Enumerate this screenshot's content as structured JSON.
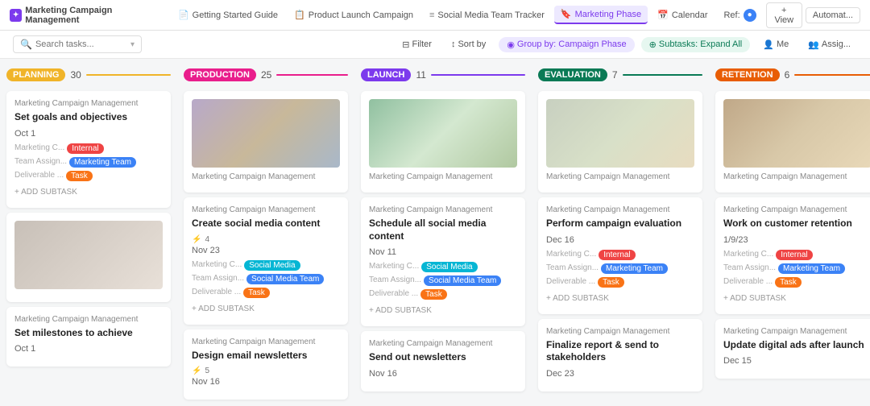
{
  "app": {
    "title": "Marketing Campaign Management",
    "logo_symbol": "✦"
  },
  "tabs": [
    {
      "id": "getting-started",
      "label": "Getting Started Guide",
      "icon": "📄",
      "active": false
    },
    {
      "id": "product-launch",
      "label": "Product Launch Campaign",
      "icon": "📋",
      "active": false
    },
    {
      "id": "social-media",
      "label": "Social Media Team Tracker",
      "icon": "≡",
      "active": false
    },
    {
      "id": "marketing-phase",
      "label": "Marketing Phase",
      "icon": "🔖",
      "active": true
    },
    {
      "id": "calendar",
      "label": "Calendar",
      "icon": "📅",
      "active": false
    },
    {
      "id": "ref",
      "label": "Ref:",
      "icon": "",
      "active": false
    }
  ],
  "toolbar": {
    "search_placeholder": "Search tasks...",
    "filter_label": "Filter",
    "sort_label": "Sort by",
    "group_label": "Group by: Campaign Phase",
    "subtasks_label": "Subtasks: Expand All",
    "me_label": "Me",
    "assigni_label": "Assig..."
  },
  "view_btn": "+ View",
  "automate_btn": "Automat...",
  "columns": [
    {
      "id": "planning",
      "badge": "PLANNING",
      "badge_class": "planning",
      "count": 30,
      "cards": [
        {
          "id": "p1",
          "meta": "Marketing Campaign Management",
          "title": "Set goals and objectives",
          "date": "Oct 1",
          "tags_row1": [
            {
              "label": "Marketing C...",
              "type": "label"
            },
            {
              "label": "Internal",
              "type": "internal"
            }
          ],
          "tags_row2": [
            {
              "label": "Team Assign...",
              "type": "label"
            },
            {
              "label": "Marketing Team",
              "type": "marketing-team"
            }
          ],
          "tags_row3": [
            {
              "label": "Deliverable ...",
              "type": "label"
            },
            {
              "label": "Task",
              "type": "task"
            }
          ],
          "add_subtask": "+ ADD SUBTASK",
          "has_image": false
        },
        {
          "id": "p2",
          "meta": "",
          "title": "",
          "date": "",
          "has_image": true,
          "img_class": "img-planning",
          "tags_row1": [],
          "tags_row2": [],
          "tags_row3": [],
          "add_subtask": ""
        },
        {
          "id": "p3",
          "meta": "Marketing Campaign Management",
          "title": "Set milestones to achieve",
          "date": "Oct 1",
          "has_image": false,
          "tags_row1": [],
          "tags_row2": [],
          "tags_row3": [],
          "add_subtask": ""
        }
      ]
    },
    {
      "id": "production",
      "badge": "PRODUCTION",
      "badge_class": "production",
      "count": 25,
      "cards": [
        {
          "id": "pr1",
          "meta": "Marketing Campaign Management",
          "title": "",
          "date": "",
          "has_image": true,
          "img_class": "img-production",
          "tags_row1": [],
          "tags_row2": [],
          "tags_row3": [],
          "add_subtask": ""
        },
        {
          "id": "pr2",
          "meta": "Marketing Campaign Management",
          "title": "Create social media content",
          "date": "Nov 23",
          "subtask_count": "4",
          "tags_row1": [
            {
              "label": "Marketing C...",
              "type": "label"
            },
            {
              "label": "Social Media",
              "type": "social-media"
            }
          ],
          "tags_row2": [
            {
              "label": "Team Assign...",
              "type": "label"
            },
            {
              "label": "Social Media Team",
              "type": "marketing-team"
            }
          ],
          "tags_row3": [
            {
              "label": "Deliverable ...",
              "type": "label"
            },
            {
              "label": "Task",
              "type": "task"
            }
          ],
          "add_subtask": "+ ADD SUBTASK",
          "has_image": false
        },
        {
          "id": "pr3",
          "meta": "Marketing Campaign Management",
          "title": "Design email newsletters",
          "date": "Nov 16",
          "subtask_count": "5",
          "has_image": false,
          "tags_row1": [],
          "tags_row2": [],
          "tags_row3": [],
          "add_subtask": ""
        }
      ]
    },
    {
      "id": "launch",
      "badge": "LAUNCH",
      "badge_class": "launch",
      "count": 11,
      "cards": [
        {
          "id": "l1",
          "meta": "Marketing Campaign Management",
          "title": "",
          "date": "",
          "has_image": true,
          "img_class": "img-launch",
          "tags_row1": [],
          "tags_row2": [],
          "tags_row3": [],
          "add_subtask": ""
        },
        {
          "id": "l2",
          "meta": "Marketing Campaign Management",
          "title": "Schedule all social media content",
          "date": "Nov 11",
          "tags_row1": [
            {
              "label": "Marketing C...",
              "type": "label"
            },
            {
              "label": "Social Media",
              "type": "social-media"
            }
          ],
          "tags_row2": [
            {
              "label": "Team Assign...",
              "type": "label"
            },
            {
              "label": "Social Media Team",
              "type": "marketing-team"
            }
          ],
          "tags_row3": [
            {
              "label": "Deliverable ...",
              "type": "label"
            },
            {
              "label": "Task",
              "type": "task"
            }
          ],
          "add_subtask": "+ ADD SUBTASK",
          "has_image": false
        },
        {
          "id": "l3",
          "meta": "Marketing Campaign Management",
          "title": "Send out newsletters",
          "date": "Nov 16",
          "has_image": false,
          "tags_row1": [],
          "tags_row2": [],
          "tags_row3": [],
          "add_subtask": ""
        }
      ]
    },
    {
      "id": "evaluation",
      "badge": "EVALUATION",
      "badge_class": "evaluation",
      "count": 7,
      "cards": [
        {
          "id": "e1",
          "meta": "Marketing Campaign Management",
          "title": "",
          "date": "",
          "has_image": true,
          "img_class": "img-evaluation",
          "tags_row1": [],
          "tags_row2": [],
          "tags_row3": [],
          "add_subtask": ""
        },
        {
          "id": "e2",
          "meta": "Marketing Campaign Management",
          "title": "Perform campaign evaluation",
          "date": "Dec 16",
          "tags_row1": [
            {
              "label": "Marketing C...",
              "type": "label"
            },
            {
              "label": "Internal",
              "type": "internal"
            }
          ],
          "tags_row2": [
            {
              "label": "Team Assign...",
              "type": "label"
            },
            {
              "label": "Marketing Team",
              "type": "marketing-team"
            }
          ],
          "tags_row3": [
            {
              "label": "Deliverable ...",
              "type": "label"
            },
            {
              "label": "Task",
              "type": "task"
            }
          ],
          "add_subtask": "+ ADD SUBTASK",
          "has_image": false
        },
        {
          "id": "e3",
          "meta": "Marketing Campaign Management",
          "title": "Finalize report & send to stakeholders",
          "date": "Dec 23",
          "has_image": false,
          "tags_row1": [],
          "tags_row2": [],
          "tags_row3": [],
          "add_subtask": ""
        }
      ]
    },
    {
      "id": "retention",
      "badge": "RETENTION",
      "badge_class": "retention",
      "count": 6,
      "cards": [
        {
          "id": "r1",
          "meta": "Marketing Campaign Management",
          "title": "",
          "date": "",
          "has_image": true,
          "img_class": "img-retention",
          "tags_row1": [],
          "tags_row2": [],
          "tags_row3": [],
          "add_subtask": ""
        },
        {
          "id": "r2",
          "meta": "Marketing Campaign Management",
          "title": "Work on customer retention",
          "date": "1/9/23",
          "tags_row1": [
            {
              "label": "Marketing C...",
              "type": "label"
            },
            {
              "label": "Internal",
              "type": "internal"
            }
          ],
          "tags_row2": [
            {
              "label": "Team Assign...",
              "type": "label"
            },
            {
              "label": "Marketing Team",
              "type": "marketing-team"
            }
          ],
          "tags_row3": [
            {
              "label": "Deliverable ...",
              "type": "label"
            },
            {
              "label": "Task",
              "type": "task"
            }
          ],
          "add_subtask": "+ ADD SUBTASK",
          "has_image": false
        },
        {
          "id": "r3",
          "meta": "Marketing Campaign Management",
          "title": "Update digital ads after launch",
          "date": "Dec 15",
          "has_image": false,
          "tags_row1": [],
          "tags_row2": [],
          "tags_row3": [],
          "add_subtask": ""
        }
      ]
    }
  ]
}
